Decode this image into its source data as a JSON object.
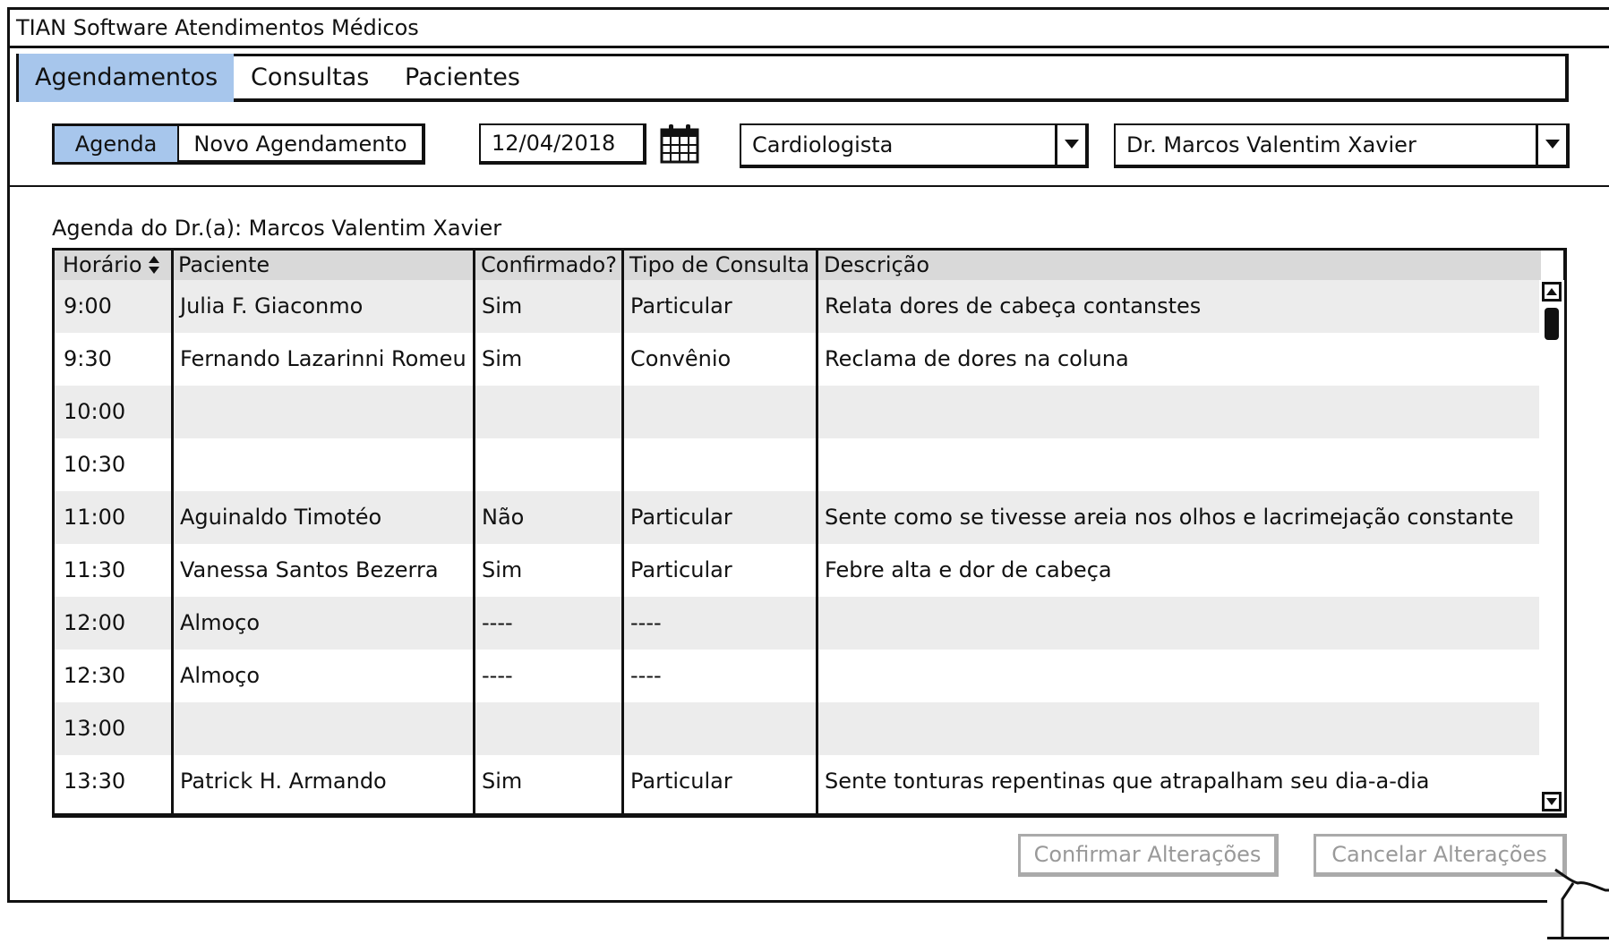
{
  "window": {
    "title": "TIAN Software Atendimentos Médicos"
  },
  "tabs": [
    {
      "label": "Agendamentos",
      "selected": true
    },
    {
      "label": "Consultas",
      "selected": false
    },
    {
      "label": "Pacientes",
      "selected": false
    }
  ],
  "toolbar": {
    "view_toggle": [
      {
        "label": "Agenda",
        "selected": true
      },
      {
        "label": "Novo Agendamento",
        "selected": false
      }
    ],
    "date": {
      "value": "12/04/2018",
      "icon": "calendar-icon"
    },
    "specialty": {
      "value": "Cardiologista"
    },
    "doctor": {
      "value": "Dr. Marcos Valentim Xavier"
    }
  },
  "agenda": {
    "label": "Agenda do Dr.(a): Marcos Valentim Xavier",
    "columns": [
      "Horário",
      "Paciente",
      "Confirmado?",
      "Tipo de Consulta",
      "Descrição"
    ],
    "sort_icon": "sort-arrows-icon",
    "rows": [
      {
        "time": "9:00",
        "patient": "Julia F. Giaconmo",
        "confirmed": "Sim",
        "type": "Particular",
        "description": "Relata dores de cabeça contanstes"
      },
      {
        "time": "9:30",
        "patient": "Fernando Lazarinni Romeu",
        "confirmed": "Sim",
        "type": "Convênio",
        "description": "Reclama de dores na coluna"
      },
      {
        "time": "10:00",
        "patient": "",
        "confirmed": "",
        "type": "",
        "description": ""
      },
      {
        "time": "10:30",
        "patient": "",
        "confirmed": "",
        "type": "",
        "description": ""
      },
      {
        "time": "11:00",
        "patient": "Aguinaldo Timotéo",
        "confirmed": "Não",
        "type": "Particular",
        "description": "Sente como se tivesse areia nos olhos e lacrimejação constante"
      },
      {
        "time": "11:30",
        "patient": "Vanessa Santos Bezerra",
        "confirmed": "Sim",
        "type": "Particular",
        "description": "Febre alta e dor de cabeça"
      },
      {
        "time": "12:00",
        "patient": "Almoço",
        "confirmed": "----",
        "type": "----",
        "description": ""
      },
      {
        "time": "12:30",
        "patient": "Almoço",
        "confirmed": "----",
        "type": "----",
        "description": ""
      },
      {
        "time": "13:00",
        "patient": "",
        "confirmed": "",
        "type": "",
        "description": ""
      },
      {
        "time": "13:30",
        "patient": "Patrick H. Armando",
        "confirmed": "Sim",
        "type": "Particular",
        "description": "Sente tonturas repentinas que atrapalham seu dia-a-dia"
      }
    ]
  },
  "actions": {
    "confirm_label": "Confirmar Alterações",
    "cancel_label": "Cancelar Alterações"
  },
  "colors": {
    "selected_tab": "#a7c6ec",
    "row_stripe": "#ececec",
    "header_bg": "#d9d9d9",
    "disabled_text": "#999999"
  }
}
